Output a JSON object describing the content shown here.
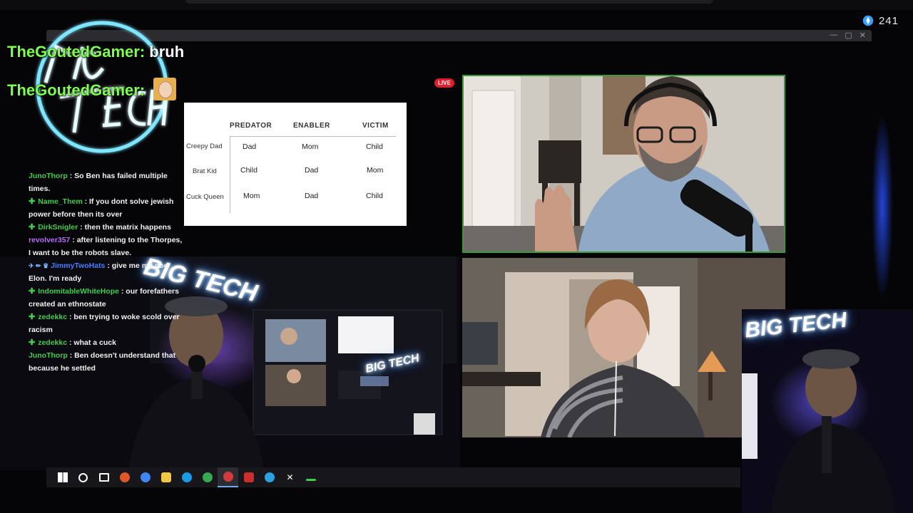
{
  "viewer_count": "241",
  "overlay_chat": [
    {
      "username": "TheGoutedGamer",
      "separator": ":",
      "message": "bruh"
    },
    {
      "username": "TheGoutedGamer",
      "separator": ":",
      "emote": "emote-face"
    }
  ],
  "live_badge": "LIVE",
  "table": {
    "columns": [
      "PREDATOR",
      "ENABLER",
      "VICTIM"
    ],
    "rows": [
      {
        "label": "Creepy Dad",
        "cells": [
          "Dad",
          "Mom",
          "Child"
        ]
      },
      {
        "label": "Brat Kid",
        "cells": [
          "Child",
          "Dad",
          "Mom"
        ]
      },
      {
        "label": "Cuck Queen",
        "cells": [
          "Mom",
          "Dad",
          "Child"
        ]
      }
    ]
  },
  "chat_log": [
    {
      "username": "JunoThorp",
      "color": "#3ecf4a",
      "plus": false,
      "badges": "",
      "message": "So Ben has failed multiple times."
    },
    {
      "username": "Name_Them",
      "color": "#3ecf4a",
      "plus": true,
      "badges": "",
      "message": "If you dont solve jewish power before then its over"
    },
    {
      "username": "DirkSnigler",
      "color": "#3ecf4a",
      "plus": true,
      "badges": "",
      "message": "then the matrix happens"
    },
    {
      "username": "revolver357",
      "color": "#b66bff",
      "plus": false,
      "badges": "",
      "message": "after listening to the Thorpes, I want to be the robots slave."
    },
    {
      "username": "JimmyTwoHats",
      "color": "#4a7dff",
      "plus": false,
      "badges": "✈ ✏ ♛",
      "message": "give me my pod Elon. I'm ready"
    },
    {
      "username": "IndomitableWhiteHope",
      "color": "#3ecf4a",
      "plus": true,
      "badges": "",
      "message": "our forefathers created an ethnostate"
    },
    {
      "username": "zedekkc",
      "color": "#3ecf4a",
      "plus": true,
      "badges": "",
      "message": "ben trying to woke scold over racism"
    },
    {
      "username": "zedekkc",
      "color": "#3ecf4a",
      "plus": true,
      "badges": "",
      "message": "what a cuck"
    },
    {
      "username": "JunoThorp",
      "color": "#3ecf4a",
      "plus": false,
      "badges": "",
      "message": "Ben doesn't understand that because he settled"
    }
  ],
  "neon_sign": "BIG TECH",
  "window_controls": [
    "—",
    "▢",
    "✕"
  ],
  "taskbar_icons": [
    {
      "name": "windows-start-icon",
      "color": "#ffffff"
    },
    {
      "name": "search-icon",
      "color": "#ffffff"
    },
    {
      "name": "task-view-icon",
      "color": "#ffffff"
    },
    {
      "name": "copilot-icon",
      "color": "#e0572c"
    },
    {
      "name": "chrome-icon",
      "color": "#4285f4"
    },
    {
      "name": "file-explorer-icon",
      "color": "#f2c744"
    },
    {
      "name": "steam-icon",
      "color": "#1b9ae8"
    },
    {
      "name": "chrome-alt-icon",
      "color": "#34a853"
    },
    {
      "name": "obs-icon",
      "color": "#d13b3b"
    },
    {
      "name": "media-app-icon",
      "color": "#c9302c"
    },
    {
      "name": "telegram-icon",
      "color": "#2aa3e0"
    },
    {
      "name": "x-icon",
      "color": "#ffffff"
    },
    {
      "name": "terminal-icon",
      "color": "#3ecf4a"
    }
  ]
}
